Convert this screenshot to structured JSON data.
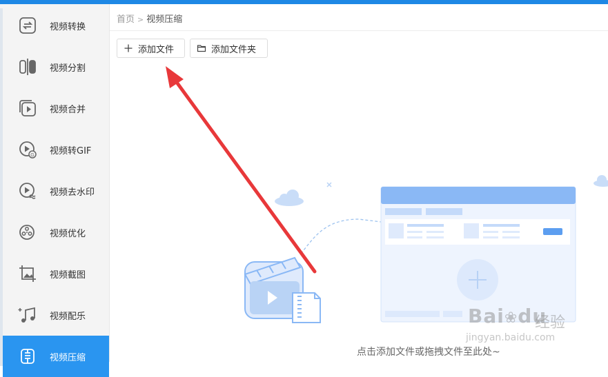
{
  "sidebar": {
    "items": [
      {
        "label": "视频转换",
        "icon": "video-convert-icon",
        "active": false
      },
      {
        "label": "视频分割",
        "icon": "video-split-icon",
        "active": false
      },
      {
        "label": "视频合并",
        "icon": "video-merge-icon",
        "active": false
      },
      {
        "label": "视频转GIF",
        "icon": "video-gif-icon",
        "active": false
      },
      {
        "label": "视频去水印",
        "icon": "video-watermark-icon",
        "active": false
      },
      {
        "label": "视频优化",
        "icon": "video-optimize-icon",
        "active": false
      },
      {
        "label": "视频截图",
        "icon": "video-screenshot-icon",
        "active": false
      },
      {
        "label": "视频配乐",
        "icon": "video-music-icon",
        "active": false
      },
      {
        "label": "视频压缩",
        "icon": "video-compress-icon",
        "active": true
      }
    ]
  },
  "breadcrumb": {
    "home": "首页",
    "current": "视频压缩"
  },
  "toolbar": {
    "add_file": "添加文件",
    "add_folder": "添加文件夹"
  },
  "dropzone": {
    "hint": "点击添加文件或拖拽文件至此处~"
  },
  "watermark": {
    "brand": "Bai",
    "brand2": "du",
    "product": "经验",
    "url": "jingyan.baidu.com"
  },
  "colors": {
    "accent": "#2a95f0",
    "arrow": "#e8383a",
    "illustration": "#8ab8f5"
  }
}
